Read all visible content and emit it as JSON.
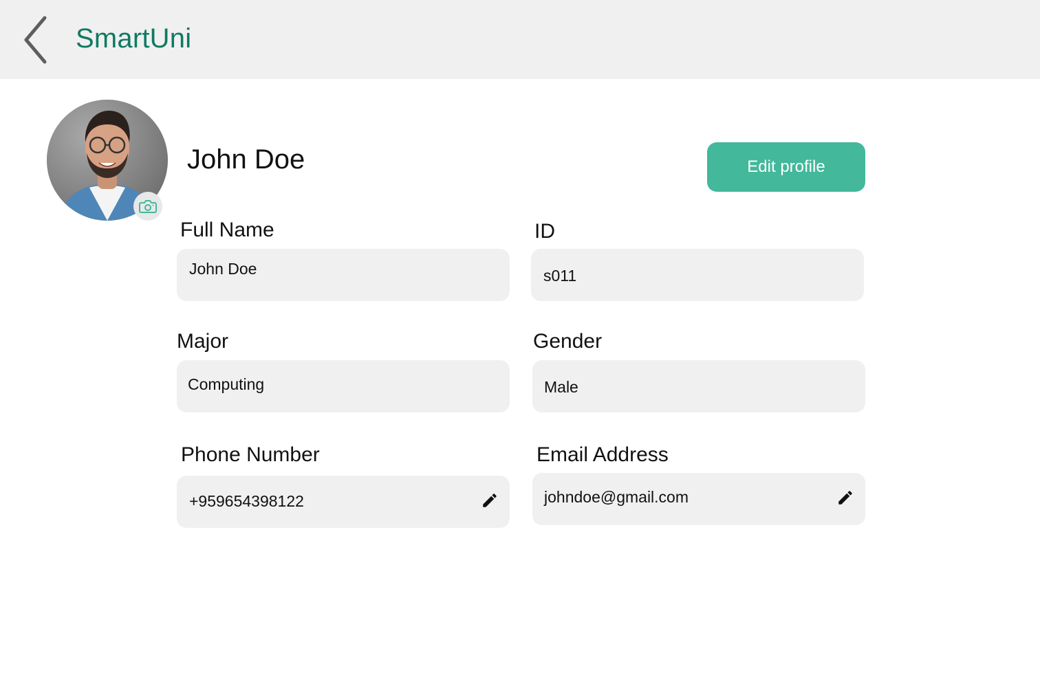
{
  "header": {
    "title": "SmartUni",
    "back_icon": "chevron-left-icon"
  },
  "profile": {
    "name": "John Doe",
    "camera_icon": "camera-icon",
    "edit_label": "Edit profile"
  },
  "fields": {
    "full_name": {
      "label": "Full Name",
      "value": "John Doe"
    },
    "id": {
      "label": "ID",
      "value": "s011"
    },
    "major": {
      "label": "Major",
      "value": "Computing"
    },
    "gender": {
      "label": "Gender",
      "value": "Male"
    },
    "phone": {
      "label": "Phone Number",
      "value": "+959654398122",
      "edit_icon": "pencil-icon"
    },
    "email": {
      "label": "Email Address",
      "value": "johndoe@gmail.com",
      "edit_icon": "pencil-icon"
    }
  },
  "colors": {
    "brand": "#0f7a62",
    "accent_button": "#43b89b",
    "surface": "#f0f0f0"
  }
}
